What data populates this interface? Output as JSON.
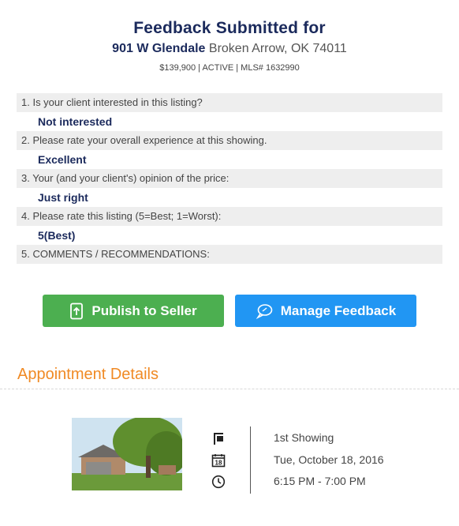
{
  "header": {
    "title": "Feedback Submitted for",
    "street": "901 W Glendale",
    "city": "Broken Arrow, OK 74011",
    "meta": "$139,900 | ACTIVE | MLS# 1632990"
  },
  "questions": [
    {
      "q": "1. Is your client interested in this listing?",
      "a": "Not interested"
    },
    {
      "q": "2. Please rate your overall experience at this showing.",
      "a": "Excellent"
    },
    {
      "q": "3. Your (and your client's) opinion of the price:",
      "a": "Just right"
    },
    {
      "q": "4. Please rate this listing (5=Best; 1=Worst):",
      "a": "5(Best)"
    },
    {
      "q": "5. COMMENTS / RECOMMENDATIONS:",
      "a": ""
    }
  ],
  "buttons": {
    "publish": "Publish to Seller",
    "manage": "Manage Feedback"
  },
  "appointment": {
    "title": "Appointment Details",
    "showing": "1st Showing",
    "date": "Tue, October 18, 2016",
    "date_icon_day": "18",
    "time": "6:15 PM - 7:00 PM"
  },
  "colors": {
    "navy": "#1b2a5c",
    "publish_green": "#4caf50",
    "manage_blue": "#2196f3",
    "section_orange": "#f08a24"
  }
}
